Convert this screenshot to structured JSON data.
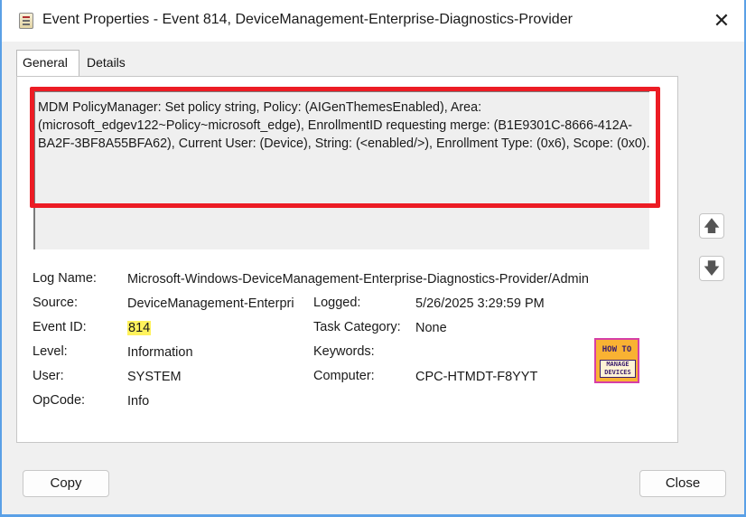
{
  "window": {
    "title": "Event Properties - Event 814, DeviceManagement-Enterprise-Diagnostics-Provider",
    "close_glyph": "✕"
  },
  "tabs": [
    {
      "label": "General",
      "selected": true
    },
    {
      "label": "Details",
      "selected": false
    }
  ],
  "message": "MDM PolicyManager: Set policy string, Policy: (AIGenThemesEnabled), Area: (microsoft_edgev122~Policy~microsoft_edge), EnrollmentID requesting merge: (B1E9301C-8666-412A-BA2F-3BF8A55BFA62), Current User: (Device), String: (<enabled/>), Enrollment Type: (0x6), Scope: (0x0).",
  "scroll": {
    "up_icon": "arrow-up-icon",
    "down_icon": "arrow-down-icon",
    "up_glyph": "🡅",
    "down_glyph": "🡇"
  },
  "details": {
    "log_name": {
      "label": "Log Name:",
      "value": "Microsoft-Windows-DeviceManagement-Enterprise-Diagnostics-Provider/Admin"
    },
    "source": {
      "label": "Source:",
      "value": "DeviceManagement-Enterpri"
    },
    "logged": {
      "label": "Logged:",
      "value": "5/26/2025 3:29:59 PM"
    },
    "event_id": {
      "label": "Event ID:",
      "value": "814"
    },
    "task_category": {
      "label": "Task Category:",
      "value": "None"
    },
    "level": {
      "label": "Level:",
      "value": "Information"
    },
    "keywords": {
      "label": "Keywords:",
      "value": ""
    },
    "user": {
      "label": "User:",
      "value": "SYSTEM"
    },
    "computer": {
      "label": "Computer:",
      "value": "CPC-HTMDT-F8YYT"
    },
    "opcode": {
      "label": "OpCode:",
      "value": "Info"
    }
  },
  "logo": {
    "line1": "HOW TO",
    "line2": "MANAGE DEVICES"
  },
  "buttons": {
    "copy": "Copy",
    "close": "Close"
  },
  "colors": {
    "highlight_border": "#ec1c24",
    "event_id_highlight": "#fff25c",
    "window_border": "#5aa0e6"
  }
}
